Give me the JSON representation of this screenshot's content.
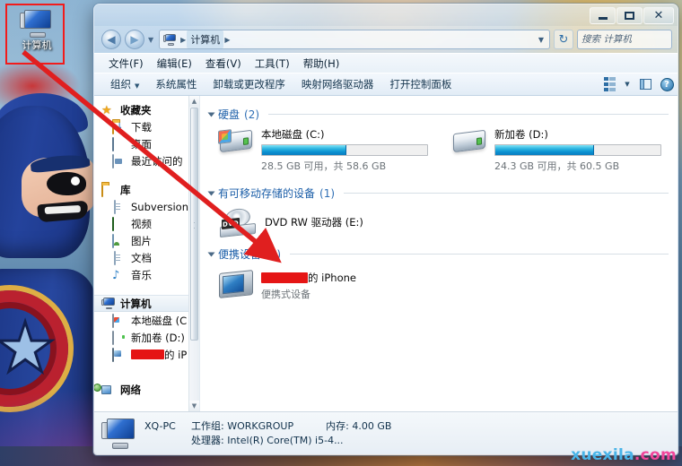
{
  "desktop": {
    "icon": {
      "label": "计算机",
      "name": "computer-icon"
    },
    "highlight_color": "#f21b1b"
  },
  "annotation": {
    "arrow_color": "#e01f1f",
    "from": "desktop-computer-icon",
    "to": "portable-devices-group"
  },
  "watermark": {
    "part1": "xuexila",
    "part2": ".com"
  },
  "window": {
    "controls": {
      "minimize": "–",
      "maximize": "□",
      "close": "✕"
    },
    "nav": {
      "back": "◀",
      "forward": "▶",
      "recent_caret": "▼"
    },
    "breadcrumb": {
      "root": "计算机",
      "sep": "▶",
      "caret": "▼"
    },
    "refresh": "↻",
    "search": {
      "placeholder": "搜索 计算机",
      "value": "",
      "icon": "⚲"
    }
  },
  "menubar": {
    "items": [
      {
        "label": "文件(F)"
      },
      {
        "label": "编辑(E)"
      },
      {
        "label": "查看(V)"
      },
      {
        "label": "工具(T)"
      },
      {
        "label": "帮助(H)"
      }
    ]
  },
  "commandbar": {
    "organize": "组织",
    "organize_caret": "▼",
    "items": [
      {
        "label": "系统属性"
      },
      {
        "label": "卸载或更改程序"
      },
      {
        "label": "映射网络驱动器"
      },
      {
        "label": "打开控制面板"
      }
    ],
    "views_caret": "▼",
    "help_glyph": "?"
  },
  "sidebar": {
    "groups": [
      {
        "root": {
          "label": "收藏夹",
          "icon": "star-icon"
        },
        "children": [
          {
            "label": "下载",
            "icon": "downloads-folder-icon"
          },
          {
            "label": "桌面",
            "icon": "desktop-icon"
          },
          {
            "label": "最近访问的",
            "icon": "recent-places-icon"
          }
        ]
      },
      {
        "root": {
          "label": "库",
          "icon": "library-folder-icon"
        },
        "children": [
          {
            "label": "Subversion",
            "icon": "document-icon"
          },
          {
            "label": "视频",
            "icon": "video-icon"
          },
          {
            "label": "图片",
            "icon": "pictures-icon"
          },
          {
            "label": "文档",
            "icon": "documents-icon"
          },
          {
            "label": "音乐",
            "icon": "music-note-icon"
          }
        ]
      },
      {
        "root": {
          "label": "计算机",
          "icon": "computer-icon",
          "selected": true
        },
        "children": [
          {
            "label": "本地磁盘 (C",
            "icon": "windows-drive-icon"
          },
          {
            "label": "新加卷 (D:)",
            "icon": "hard-drive-icon"
          },
          {
            "label": "的 iP",
            "icon": "portable-device-icon",
            "redacted": true
          }
        ]
      },
      {
        "root": {
          "label": "网络",
          "icon": "network-icon"
        },
        "children": []
      }
    ]
  },
  "content": {
    "groups": [
      {
        "title": "硬盘",
        "count": "(2)",
        "type": "drives",
        "drives": [
          {
            "name": "本地磁盘 (C:)",
            "free_text": "28.5 GB 可用，共 58.6 GB",
            "free_gb": 28.5,
            "total_gb": 58.6,
            "used_percent": 51
          },
          {
            "name": "新加卷 (D:)",
            "free_text": "24.3 GB 可用，共 60.5 GB",
            "free_gb": 24.3,
            "total_gb": 60.5,
            "used_percent": 60
          }
        ]
      },
      {
        "title": "有可移动存储的设备",
        "count": "(1)",
        "type": "removable",
        "devices": [
          {
            "name": "DVD RW 驱动器 (E:)",
            "badge": "DVD"
          }
        ]
      },
      {
        "title": "便携设备",
        "count": "(1)",
        "type": "portable",
        "devices": [
          {
            "name_suffix": "的 iPhone",
            "name_redacted": true,
            "subtitle": "便携式设备"
          }
        ]
      }
    ]
  },
  "statusbar": {
    "pc_name": "XQ-PC",
    "workgroup_label": "工作组:",
    "workgroup_value": "WORKGROUP",
    "memory_label": "内存:",
    "memory_value": "4.00 GB",
    "cpu_label": "处理器:",
    "cpu_value": "Intel(R) Core(TM) i5-4..."
  }
}
